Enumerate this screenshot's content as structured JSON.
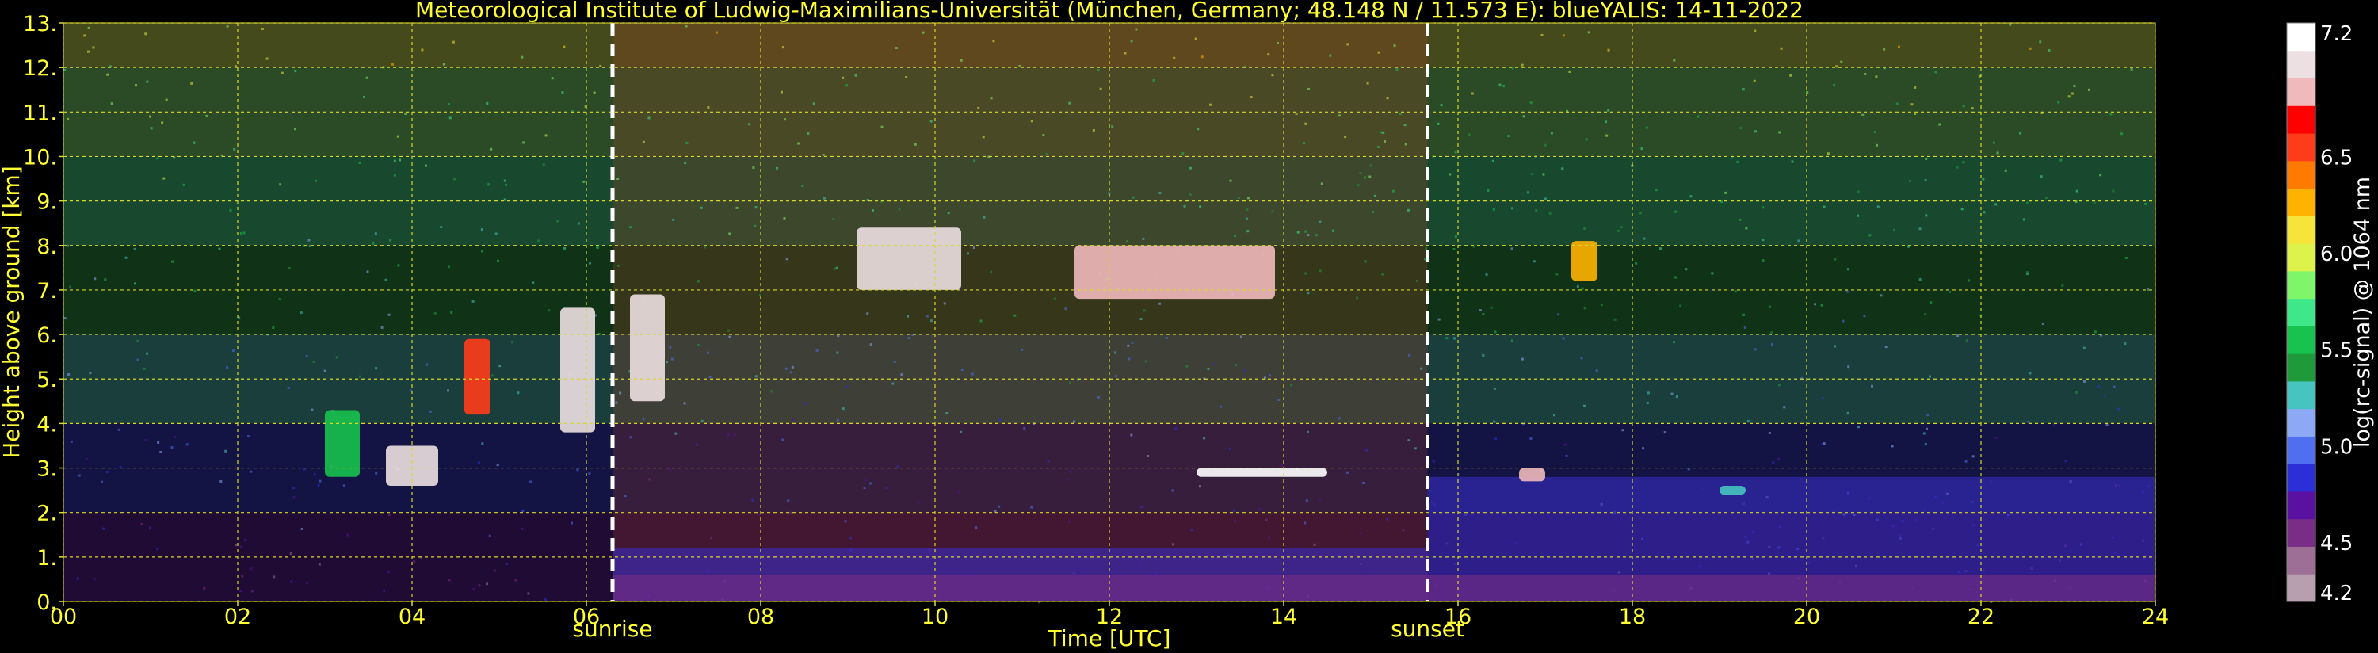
{
  "chart_data": {
    "type": "heatmap",
    "title": "Meteorological Institute of Ludwig-Maximilians-Universität (München, Germany; 48.148 N / 11.573 E):     blueYALIS: 14-11-2022",
    "xlabel": "Time [UTC]",
    "ylabel": "Height above ground [km]",
    "colorbar_label": "log(rc-signal) @ 1064 nm",
    "x_range": [
      0,
      24
    ],
    "y_range": [
      0,
      13
    ],
    "x_ticks": [
      "00",
      "02",
      "04",
      "06",
      "08",
      "10",
      "12",
      "14",
      "16",
      "18",
      "20",
      "22",
      "24"
    ],
    "x_tick_values": [
      0,
      2,
      4,
      6,
      8,
      10,
      12,
      14,
      16,
      18,
      20,
      22,
      24
    ],
    "y_ticks": [
      "0.",
      "1.",
      "2.",
      "3.",
      "4.",
      "5.",
      "6.",
      "7.",
      "8.",
      "9.",
      "10.",
      "11.",
      "12.",
      "13."
    ],
    "y_tick_values": [
      0,
      1,
      2,
      3,
      4,
      5,
      6,
      7,
      8,
      9,
      10,
      11,
      12,
      13
    ],
    "grid": true,
    "colorbar_range": [
      4.2,
      7.2
    ],
    "colorbar_ticks": [
      "4.2",
      "4.5",
      "5.0",
      "5.5",
      "6.0",
      "6.5",
      "7.2"
    ],
    "colorbar_tick_values": [
      4.2,
      4.5,
      5.0,
      5.5,
      6.0,
      6.5,
      7.2
    ],
    "colorbar_colors": [
      "#b89fb0",
      "#9d6f97",
      "#7a2d86",
      "#5a10a0",
      "#2c2fd8",
      "#4f6ff0",
      "#8da9f5",
      "#46c4c0",
      "#1f9a3a",
      "#17c24e",
      "#3ee88a",
      "#7ff56a",
      "#ddf24a",
      "#f6e43a",
      "#ffb300",
      "#ff7a00",
      "#ff3c1a",
      "#ff0000",
      "#f0b9bb",
      "#ede0e2",
      "#ffffff"
    ],
    "markers": [
      {
        "label": "sunrise",
        "x": 6.3
      },
      {
        "label": "sunset",
        "x": 15.65
      }
    ],
    "cloud_features": [
      {
        "x_start": 3.0,
        "x_end": 3.4,
        "y_bottom": 2.8,
        "y_top": 4.3,
        "level": 5.6
      },
      {
        "x_start": 3.7,
        "x_end": 4.3,
        "y_bottom": 2.6,
        "y_top": 3.5,
        "level": 7.0
      },
      {
        "x_start": 4.6,
        "x_end": 4.9,
        "y_bottom": 4.2,
        "y_top": 5.9,
        "level": 6.6
      },
      {
        "x_start": 5.7,
        "x_end": 6.1,
        "y_bottom": 3.8,
        "y_top": 6.6,
        "level": 7.0
      },
      {
        "x_start": 6.5,
        "x_end": 6.9,
        "y_bottom": 4.5,
        "y_top": 6.9,
        "level": 7.0
      },
      {
        "x_start": 9.1,
        "x_end": 10.3,
        "y_bottom": 7.0,
        "y_top": 8.4,
        "level": 7.0
      },
      {
        "x_start": 11.6,
        "x_end": 13.9,
        "y_bottom": 6.8,
        "y_top": 8.0,
        "level": 6.9
      },
      {
        "x_start": 13.0,
        "x_end": 14.5,
        "y_bottom": 2.8,
        "y_top": 3.0,
        "level": 7.2
      },
      {
        "x_start": 16.7,
        "x_end": 17.0,
        "y_bottom": 2.7,
        "y_top": 3.0,
        "level": 6.8
      },
      {
        "x_start": 17.3,
        "x_end": 17.6,
        "y_bottom": 7.2,
        "y_top": 8.1,
        "level": 6.2
      },
      {
        "x_start": 19.0,
        "x_end": 19.3,
        "y_bottom": 2.4,
        "y_top": 2.6,
        "level": 5.3
      }
    ],
    "boundary_layer": [
      {
        "x_start": 6.3,
        "x_end": 15.65,
        "y_top": 1.2
      },
      {
        "x_start": 15.65,
        "x_end": 24,
        "y_top": 2.8
      }
    ]
  }
}
